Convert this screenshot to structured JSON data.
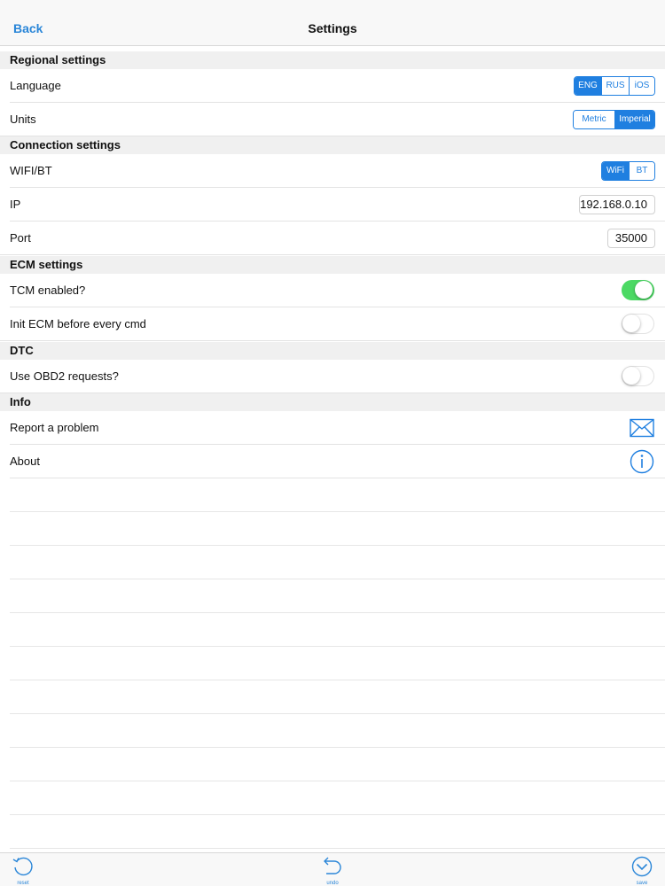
{
  "navbar": {
    "back_label": "Back",
    "title": "Settings"
  },
  "sections": {
    "regional": "Regional settings",
    "connection": "Connection settings",
    "ecm": "ECM settings",
    "dtc": "DTC",
    "info": "Info"
  },
  "rows": {
    "language": {
      "label": "Language",
      "options": [
        "ENG",
        "RUS",
        "iOS"
      ],
      "selected": "ENG"
    },
    "units": {
      "label": "Units",
      "options": [
        "Metric",
        "Imperial"
      ],
      "selected": "Imperial"
    },
    "wifi_bt": {
      "label": "WIFI/BT",
      "options": [
        "WiFi",
        "BT"
      ],
      "selected": "WiFi"
    },
    "ip": {
      "label": "IP",
      "value": "192.168.0.10"
    },
    "port": {
      "label": "Port",
      "value": "35000"
    },
    "tcm": {
      "label": "TCM enabled?",
      "on": true
    },
    "init_ecm": {
      "label": "Init ECM before every cmd",
      "on": false
    },
    "obd2": {
      "label": "Use OBD2 requests?",
      "on": false
    },
    "report": {
      "label": "Report a problem",
      "icon": "envelope-icon"
    },
    "about": {
      "label": "About",
      "icon": "info-icon"
    }
  },
  "toolbar": {
    "reset_label": "reset",
    "undo_label": "undo",
    "save_label": "save"
  },
  "colors": {
    "accent": "#1f7fe0",
    "toggle_on": "#4cd964",
    "section_bg": "#f0f0f0"
  }
}
